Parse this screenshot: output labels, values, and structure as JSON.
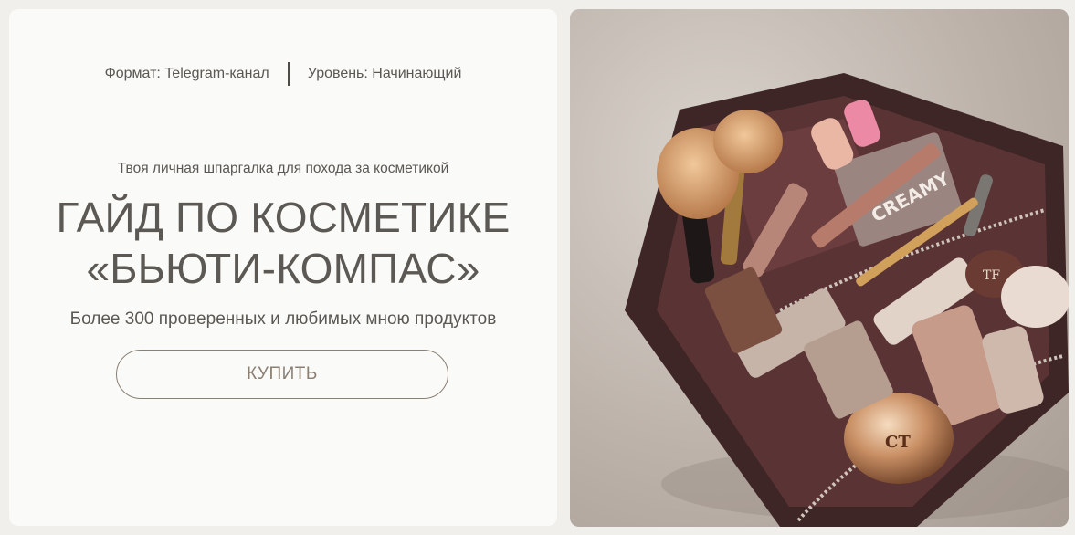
{
  "meta": {
    "format": "Формат: Telegram-канал",
    "level": "Уровень: Начинающий"
  },
  "hero": {
    "subtitle": "Твоя личная шпаргалка для похода за косметикой",
    "title_line1": "ГАЙД ПО КОСМЕТИКЕ",
    "title_line2": "«БЬЮТИ-КОМПАС»",
    "tagline": "Более 300 проверенных и любимых мною продуктов",
    "buy_label": "КУПИТЬ"
  },
  "photo": {
    "subject": "makeup-bag-photo",
    "palette_label": "CREAMY",
    "compact_label": "CT",
    "jar_label": "TF"
  },
  "colors": {
    "page_bg": "#f1efeb",
    "card_bg": "#fafaf9",
    "text": "#5c5955",
    "button_accent": "#8a7f73",
    "bag_leather": "#3e2526"
  }
}
